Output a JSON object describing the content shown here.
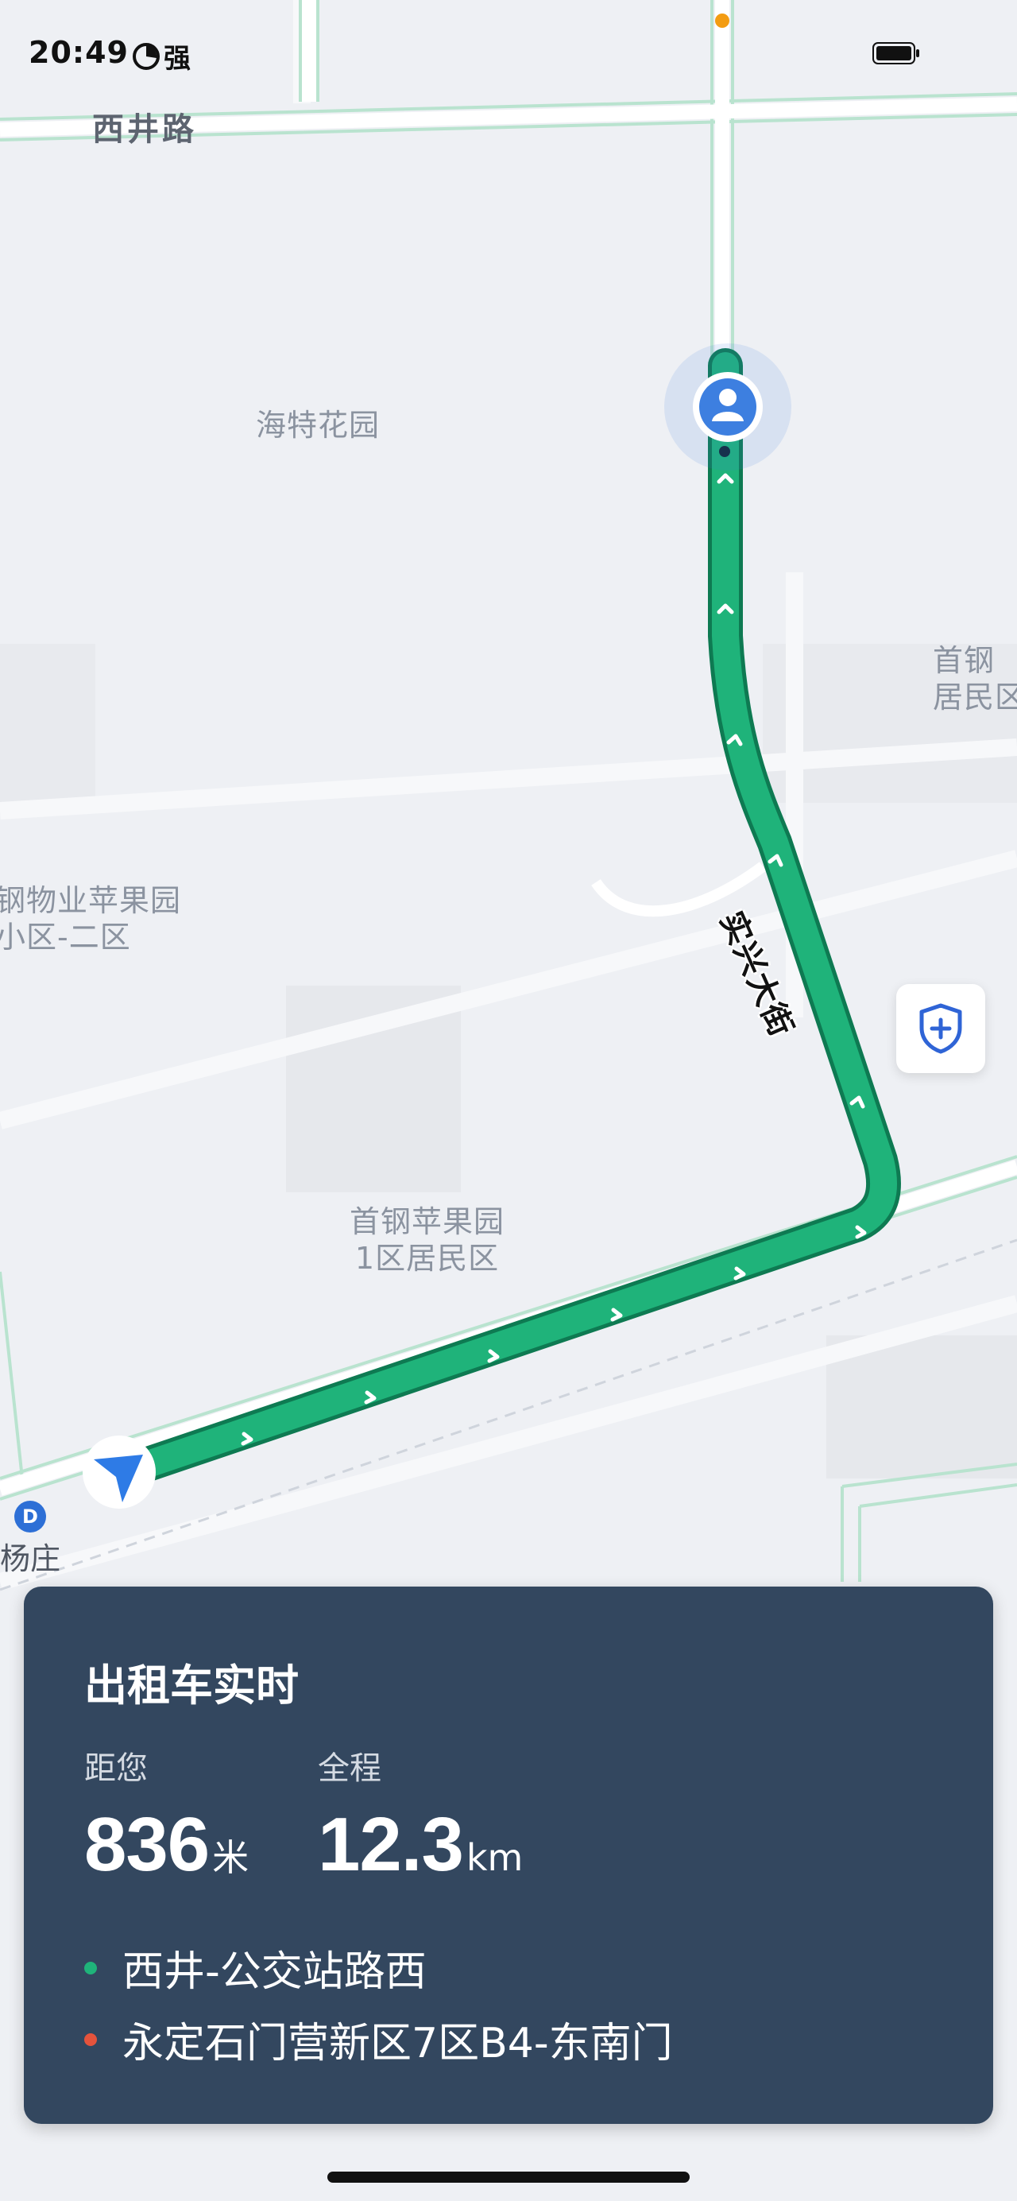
{
  "status_bar": {
    "time": "20:49",
    "network": "强"
  },
  "map": {
    "road_label": "西井路",
    "street_name": "实兴大街",
    "poi_labels": [
      {
        "id": "haite",
        "text": "海特花园"
      },
      {
        "id": "shougang-east",
        "text": "首钢\n居民区"
      },
      {
        "id": "pingguoyuan-2",
        "text": "钢物业苹果园\n小区-二区"
      },
      {
        "id": "pingguoyuan-1",
        "text": "首钢苹果园\n1区居民区"
      }
    ],
    "metro_station": {
      "badge": "D",
      "name": "杨庄"
    }
  },
  "card": {
    "title": "出租车实时",
    "distance_label": "距您",
    "distance_value": "836",
    "distance_unit": "米",
    "total_label": "全程",
    "total_value": "12.3",
    "total_unit": "km",
    "origin": "西井-公交站路西",
    "destination": "永定石门营新区7区B4-东南门"
  },
  "colors": {
    "route": "#1fb37a",
    "card_bg": "#33475f",
    "origin_dot": "#1fb37a",
    "destination_dot": "#e5533c",
    "passenger_marker": "#3d7fe0"
  }
}
